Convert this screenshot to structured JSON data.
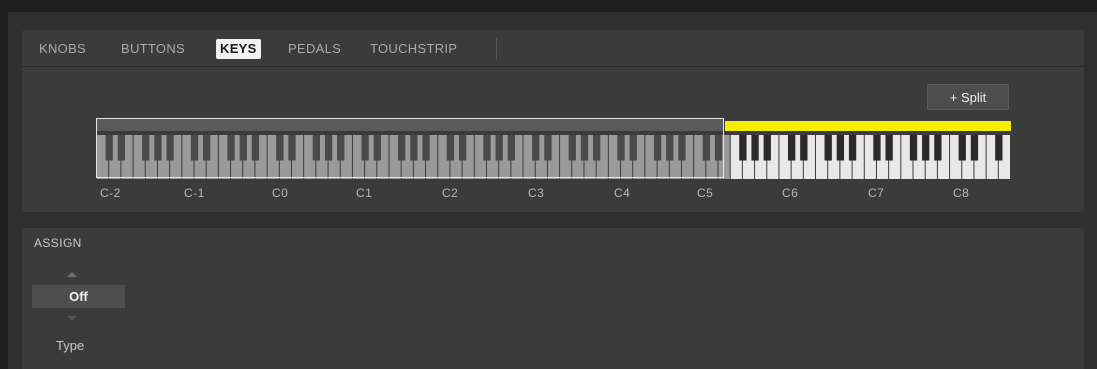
{
  "tabs": [
    {
      "label": "KNOBS",
      "active": false
    },
    {
      "label": "BUTTONS",
      "active": false
    },
    {
      "label": "KEYS",
      "active": true
    },
    {
      "label": "PEDALS",
      "active": false
    },
    {
      "label": "TOUCHSTRIP",
      "active": false
    }
  ],
  "split_button": {
    "label": "+ Split"
  },
  "keyboard": {
    "octave_labels": [
      "C-2",
      "C-1",
      "C0",
      "C1",
      "C2",
      "C3",
      "C4",
      "C5",
      "C6",
      "C7",
      "C8"
    ],
    "zone_split_after_octave": "C5",
    "left_zone_color": "#5a5a5a",
    "right_zone_color": "#f5ee00"
  },
  "assign": {
    "title": "ASSIGN",
    "value": "Off",
    "type_label": "Type"
  },
  "colors": {
    "background": "#2f2f2f",
    "panel": "#3b3b3b",
    "accent": "#f5ee00"
  }
}
